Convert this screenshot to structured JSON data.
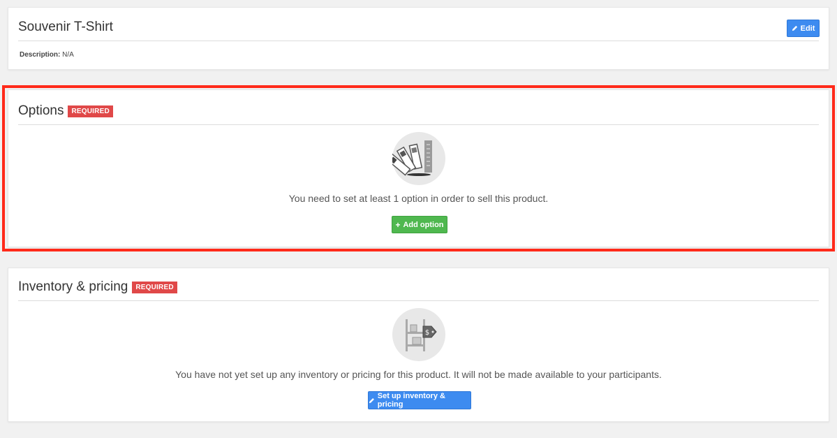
{
  "product": {
    "title": "Souvenir T-Shirt",
    "edit_label": "Edit",
    "description_label": "Description:",
    "description_value": "N/A"
  },
  "options": {
    "title": "Options",
    "badge": "REQUIRED",
    "message": "You need to set at least 1 option in order to sell this product.",
    "button_label": "Add option",
    "icon": "color-swatches-icon"
  },
  "inventory": {
    "title": "Inventory & pricing",
    "badge": "REQUIRED",
    "message": "You have not yet set up any inventory or pricing for this product. It will not be made available to your participants.",
    "button_label": "Set up inventory & pricing",
    "icon": "shelf-price-tag-icon"
  },
  "colors": {
    "accent_blue": "#3d8bf0",
    "accent_green": "#4fb84f",
    "required_red": "#e04848",
    "highlight_red": "#ff2a1a"
  }
}
